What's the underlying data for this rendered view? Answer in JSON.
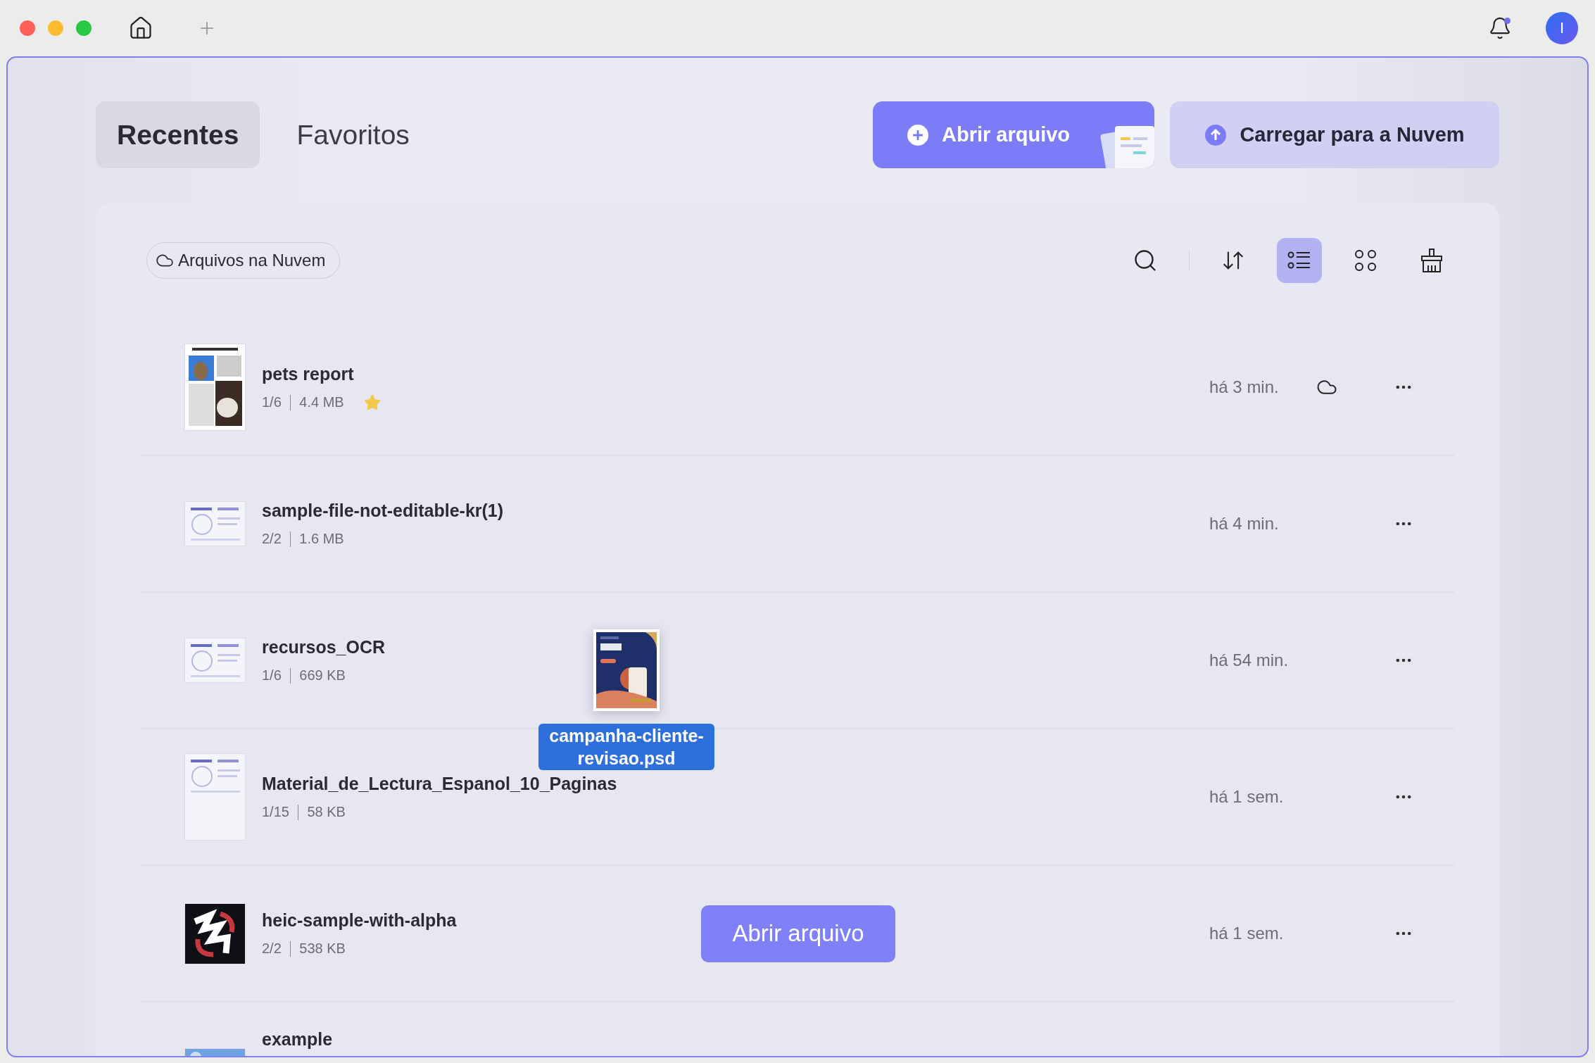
{
  "title_bar": {
    "notifications": {
      "unread": true
    },
    "avatar": "I"
  },
  "tabs": [
    {
      "label": "Recentes",
      "selected": true
    },
    {
      "label": "Favoritos",
      "selected": false
    }
  ],
  "actions": [
    {
      "kind": "primary",
      "label": "Abrir arquivo"
    },
    {
      "kind": "secondary",
      "label": "Carregar para a Nuvem"
    }
  ],
  "filter_chip": "Arquivos na Nuvem",
  "view_options": [
    {
      "kind": "list",
      "selected": true
    },
    {
      "kind": "grid",
      "selected": false
    }
  ],
  "files": [
    {
      "name": "pets report",
      "pages": "1/6",
      "size": "4.4 MB",
      "time": "há 3 min.",
      "starred": true,
      "in_cloud": true
    },
    {
      "name": "sample-file-not-editable-kr(1)",
      "pages": "2/2",
      "size": "1.6 MB",
      "time": "há 4 min.",
      "starred": false,
      "in_cloud": false
    },
    {
      "name": "recursos_OCR",
      "pages": "1/6",
      "size": "669 KB",
      "time": "há 54 min.",
      "starred": false,
      "in_cloud": false
    },
    {
      "name": "Material_de_Lectura_Espanol_10_Paginas",
      "pages": "1/15",
      "size": "58 KB",
      "time": "há 1 sem.",
      "starred": false,
      "in_cloud": false
    },
    {
      "name": "heic-sample-with-alpha",
      "pages": "2/2",
      "size": "538 KB",
      "time": "há 1 sem.",
      "starred": false,
      "in_cloud": false,
      "hover_button": "Abrir arquivo"
    },
    {
      "name": "example"
    }
  ],
  "drag_preview": {
    "label": "campanha-cliente-revisao.psd"
  }
}
